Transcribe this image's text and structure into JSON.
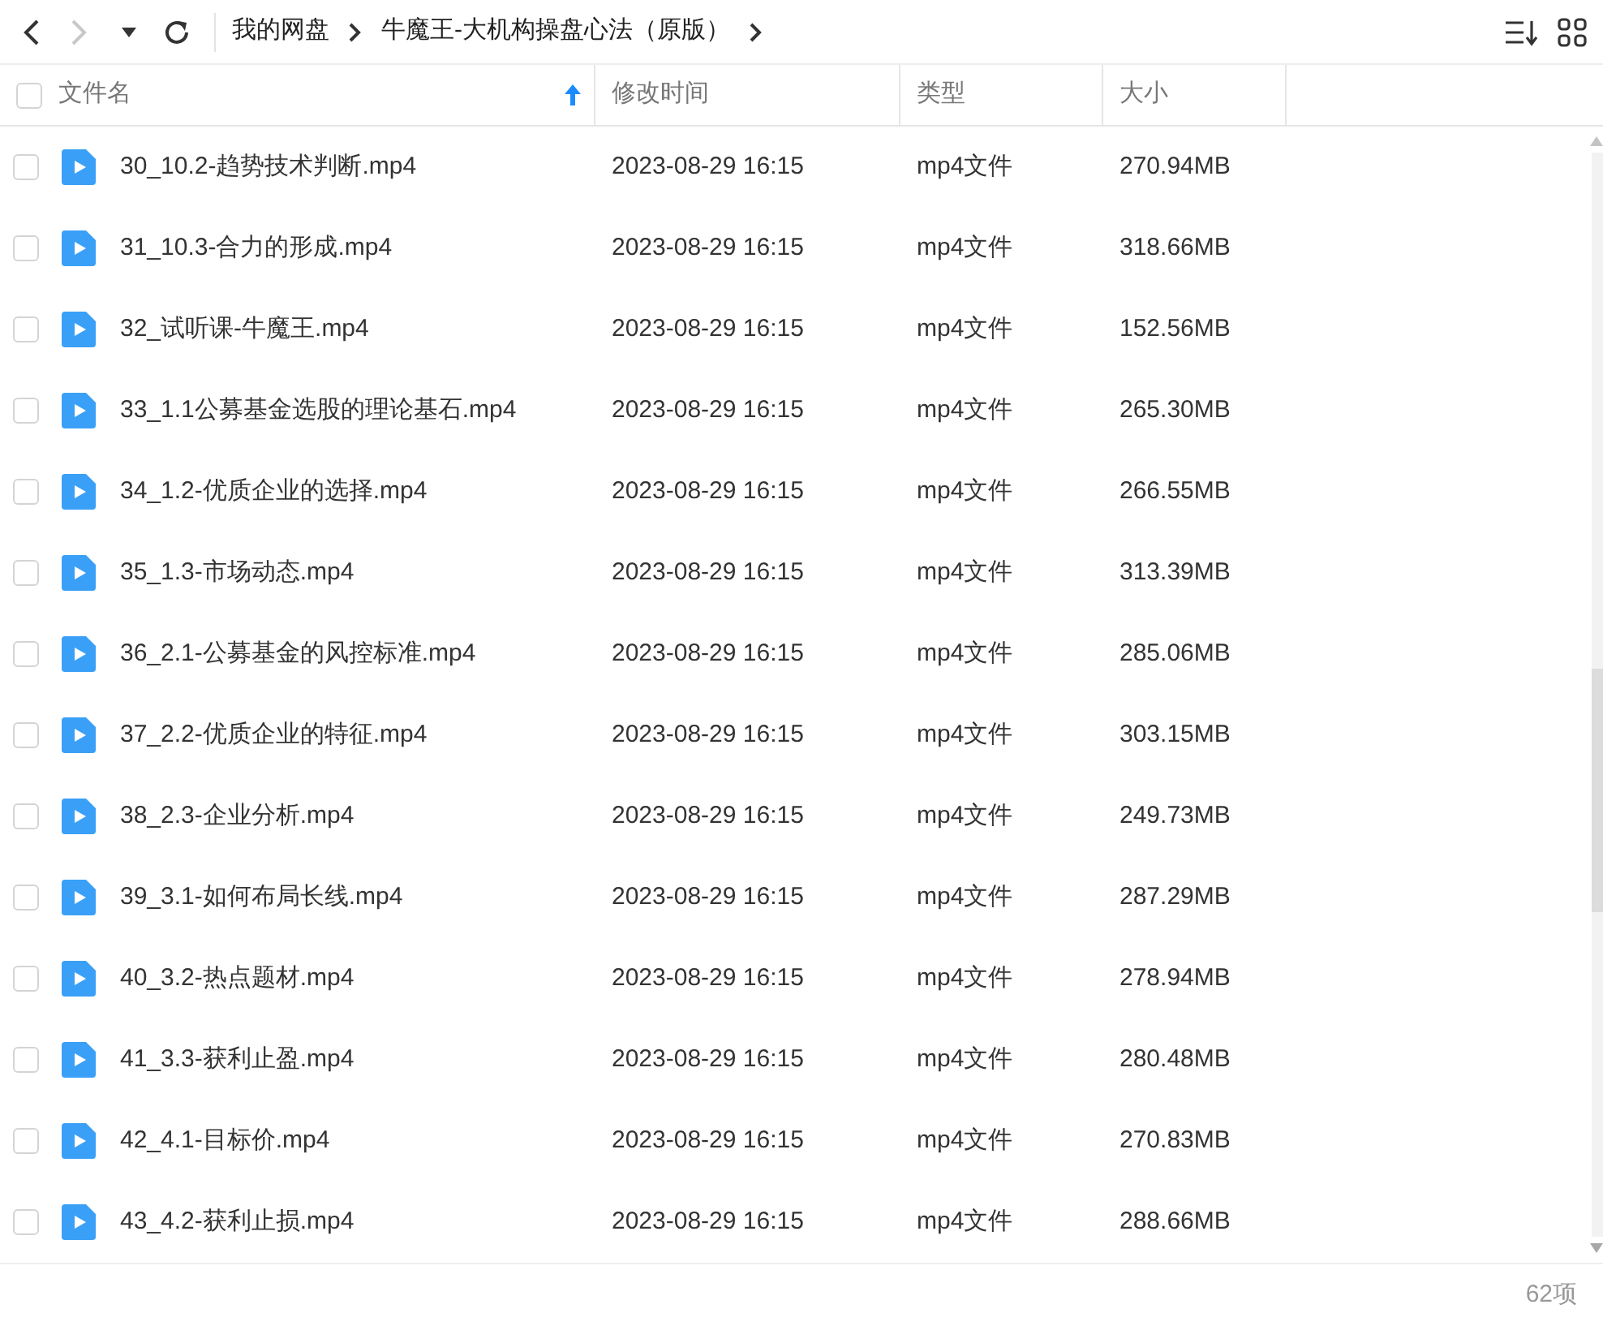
{
  "toolbar": {
    "back": {
      "disabled": false
    },
    "forward": {
      "disabled": true
    },
    "breadcrumb": [
      "我的网盘",
      "牛魔王-大机构操盘心法（原版）"
    ]
  },
  "table": {
    "select_all": {
      "checked": false
    },
    "columns": [
      {
        "label": "文件名",
        "sorted": true
      },
      {
        "label": "修改时间",
        "sorted": false
      },
      {
        "label": "类型",
        "sorted": false
      },
      {
        "label": "大小",
        "sorted": false
      }
    ],
    "rows": [
      {
        "checked": false,
        "name": "30_10.2-趋势技术判断.mp4",
        "modified": "2023-08-29 16:15",
        "type": "mp4文件",
        "size": "270.94MB"
      },
      {
        "checked": false,
        "name": "31_10.3-合力的形成.mp4",
        "modified": "2023-08-29 16:15",
        "type": "mp4文件",
        "size": "318.66MB"
      },
      {
        "checked": false,
        "name": "32_试听课-牛魔王.mp4",
        "modified": "2023-08-29 16:15",
        "type": "mp4文件",
        "size": "152.56MB"
      },
      {
        "checked": false,
        "name": "33_1.1公募基金选股的理论基石.mp4",
        "modified": "2023-08-29 16:15",
        "type": "mp4文件",
        "size": "265.30MB"
      },
      {
        "checked": false,
        "name": "34_1.2-优质企业的选择.mp4",
        "modified": "2023-08-29 16:15",
        "type": "mp4文件",
        "size": "266.55MB"
      },
      {
        "checked": false,
        "name": "35_1.3-市场动态.mp4",
        "modified": "2023-08-29 16:15",
        "type": "mp4文件",
        "size": "313.39MB"
      },
      {
        "checked": false,
        "name": "36_2.1-公募基金的风控标准.mp4",
        "modified": "2023-08-29 16:15",
        "type": "mp4文件",
        "size": "285.06MB"
      },
      {
        "checked": false,
        "name": "37_2.2-优质企业的特征.mp4",
        "modified": "2023-08-29 16:15",
        "type": "mp4文件",
        "size": "303.15MB"
      },
      {
        "checked": false,
        "name": "38_2.3-企业分析.mp4",
        "modified": "2023-08-29 16:15",
        "type": "mp4文件",
        "size": "249.73MB"
      },
      {
        "checked": false,
        "name": "39_3.1-如何布局长线.mp4",
        "modified": "2023-08-29 16:15",
        "type": "mp4文件",
        "size": "287.29MB"
      },
      {
        "checked": false,
        "name": "40_3.2-热点题材.mp4",
        "modified": "2023-08-29 16:15",
        "type": "mp4文件",
        "size": "278.94MB"
      },
      {
        "checked": false,
        "name": "41_3.3-获利止盈.mp4",
        "modified": "2023-08-29 16:15",
        "type": "mp4文件",
        "size": "280.48MB"
      },
      {
        "checked": false,
        "name": "42_4.1-目标价.mp4",
        "modified": "2023-08-29 16:15",
        "type": "mp4文件",
        "size": "270.83MB"
      },
      {
        "checked": false,
        "name": "43_4.2-获利止损.mp4",
        "modified": "2023-08-29 16:15",
        "type": "mp4文件",
        "size": "288.66MB"
      }
    ]
  },
  "status_bar": {
    "count": "62项"
  }
}
